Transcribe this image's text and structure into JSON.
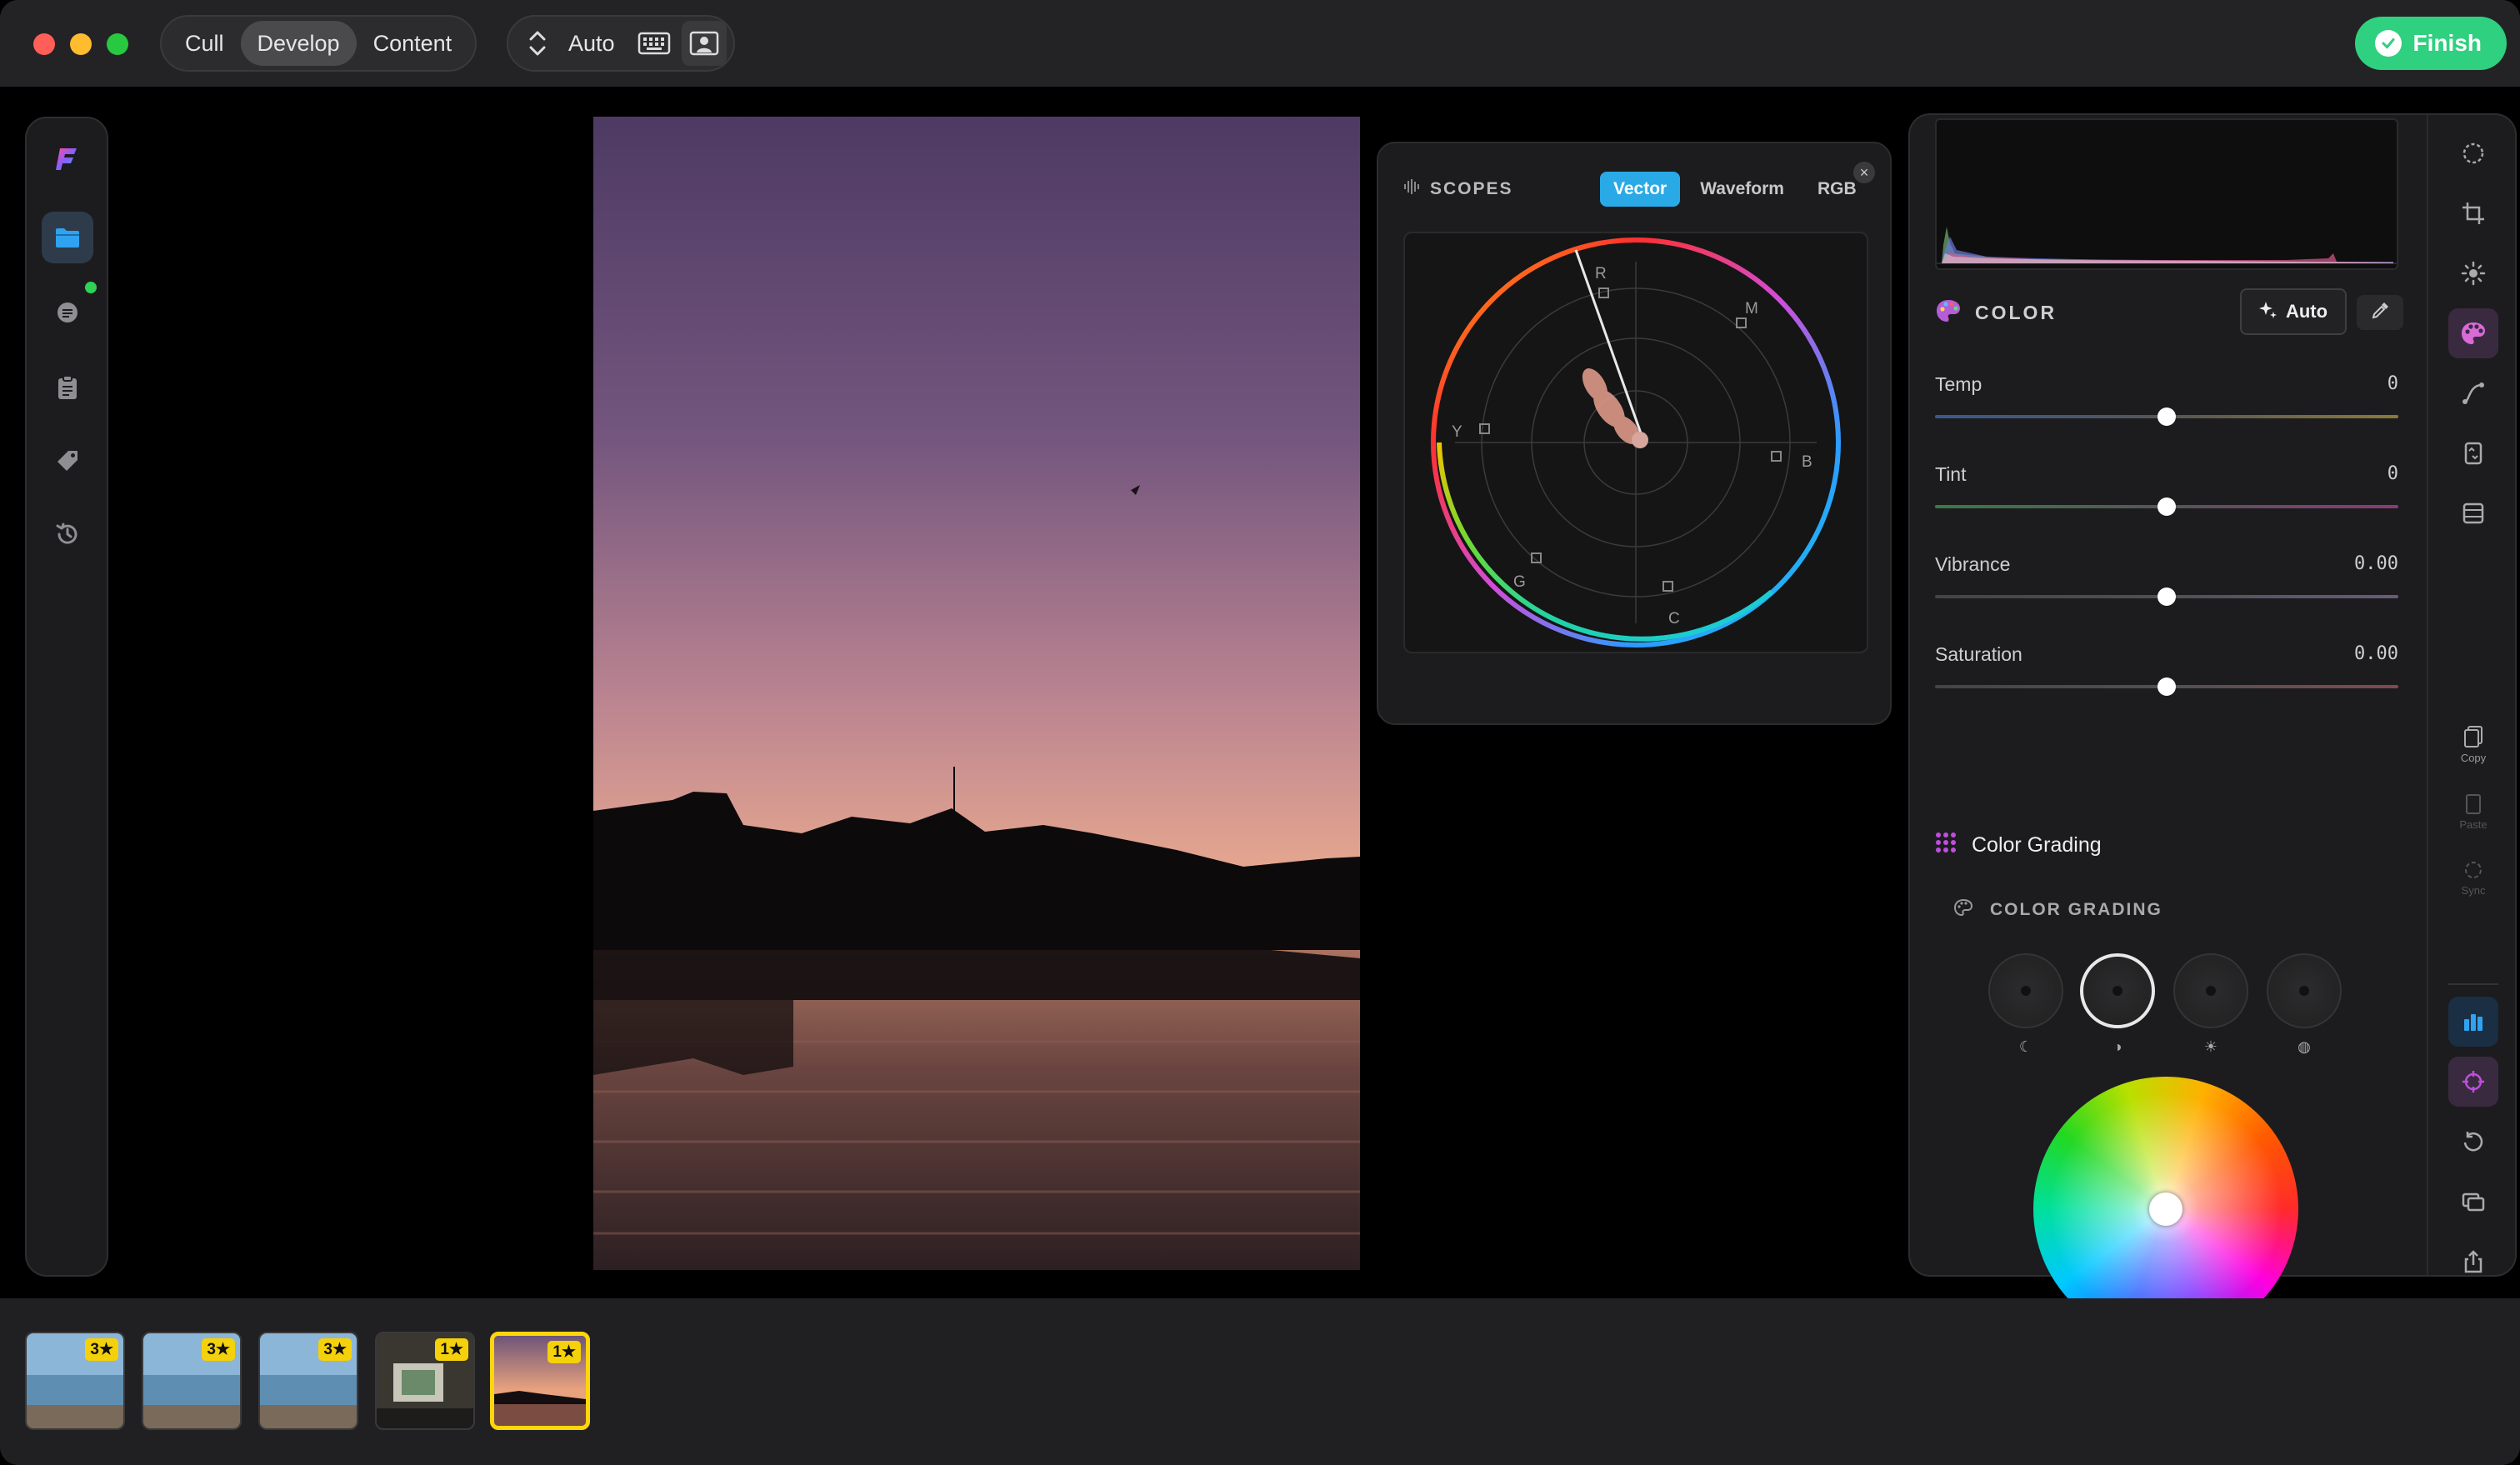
{
  "titlebar": {
    "modes": [
      "Cull",
      "Develop",
      "Content"
    ],
    "active_mode": "Develop",
    "auto_label": "Auto",
    "finish_label": "Finish"
  },
  "scopes": {
    "title": "SCOPES",
    "tabs": [
      "Vector",
      "Waveform",
      "RGB"
    ],
    "active_tab": "Vector",
    "vector_labels": {
      "r": "R",
      "m": "M",
      "y": "Y",
      "b": "B",
      "g": "G",
      "c": "C"
    }
  },
  "color": {
    "title": "COLOR",
    "auto_label": "Auto",
    "sliders": [
      {
        "label": "Temp",
        "value": "0",
        "position": 0.5
      },
      {
        "label": "Tint",
        "value": "0",
        "position": 0.5
      },
      {
        "label": "Vibrance",
        "value": "0.00",
        "position": 0.5
      },
      {
        "label": "Saturation",
        "value": "0.00",
        "position": 0.5
      }
    ]
  },
  "color_grading": {
    "section_label": "Color Grading",
    "sub_title": "COLOR GRADING",
    "wheels": [
      "shadows",
      "midtones",
      "highlights",
      "global"
    ],
    "active_wheel": "midtones"
  },
  "right_toolbar": {
    "copy_label": "Copy",
    "paste_label": "Paste",
    "sync_label": "Sync"
  },
  "filmstrip": {
    "thumbs": [
      {
        "rating": "3★",
        "kind": "sea"
      },
      {
        "rating": "3★",
        "kind": "sea"
      },
      {
        "rating": "3★",
        "kind": "sea"
      },
      {
        "rating": "1★",
        "kind": "room"
      },
      {
        "rating": "1★",
        "kind": "sunset",
        "selected": true
      }
    ]
  },
  "colors": {
    "accent_green": "#2fd07f",
    "accent_blue": "#29a9e6",
    "rating_yellow": "#f4d10a",
    "selected_border": "#ffd60a"
  }
}
